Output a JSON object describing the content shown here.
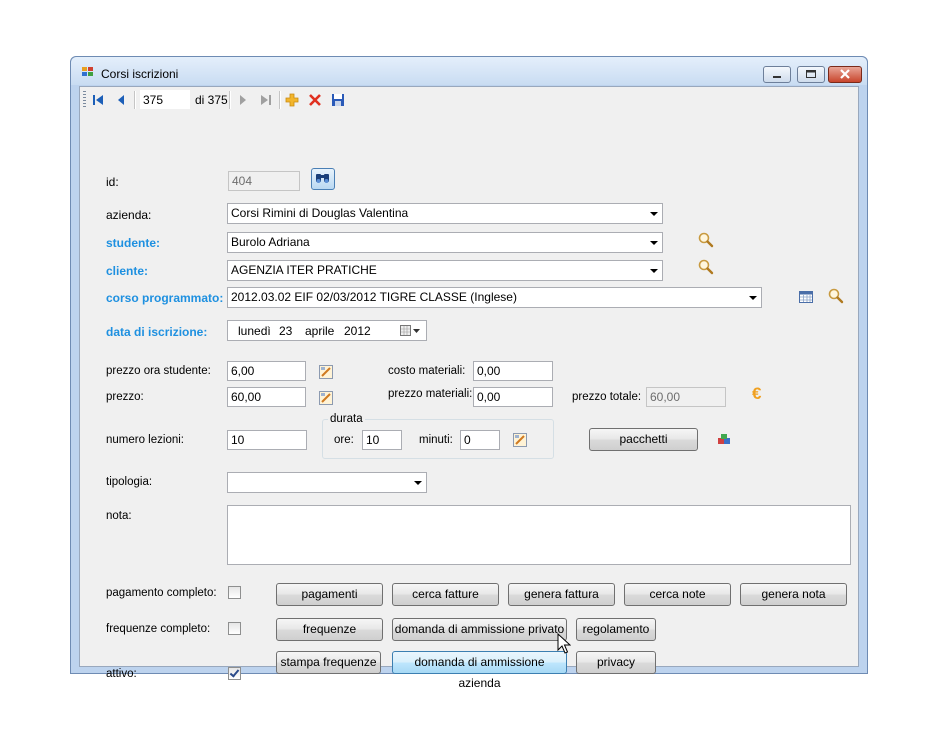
{
  "window": {
    "title": "Corsi iscrizioni"
  },
  "toolbar": {
    "position": "375",
    "count_label": "di 375"
  },
  "form": {
    "id_label": "id:",
    "id_value": "404",
    "azienda_label": "azienda:",
    "azienda_value": "Corsi Rimini di Douglas Valentina",
    "studente_label": "studente:",
    "studente_value": "Burolo Adriana",
    "cliente_label": "cliente:",
    "cliente_value": "AGENZIA ITER PRATICHE",
    "corso_label": "corso programmato:",
    "corso_value": "2012.03.02 EIF  02/03/2012 TIGRE CLASSE (Inglese)",
    "data_label": "data di iscrizione:",
    "date": {
      "weekday": "lunedì",
      "day": "23",
      "month": "aprile",
      "year": "2012"
    },
    "prezzo_ora_label": "prezzo ora studente:",
    "prezzo_ora_value": "6,00",
    "costo_materiali_label": "costo materiali:",
    "costo_materiali_value": "0,00",
    "prezzo_label": "prezzo:",
    "prezzo_value": "60,00",
    "prezzo_materiali_label": "prezzo materiali:",
    "prezzo_materiali_value": "0,00",
    "prezzo_totale_label": "prezzo totale:",
    "prezzo_totale_value": "60,00",
    "numero_lezioni_label": "numero lezioni:",
    "numero_lezioni_value": "10",
    "durata_label": "durata",
    "ore_label": "ore:",
    "ore_value": "10",
    "minuti_label": "minuti:",
    "minuti_value": "0",
    "tipologia_label": "tipologia:",
    "tipologia_value": "",
    "nota_label": "nota:",
    "nota_value": "",
    "pagamento_label": "pagamento completo:",
    "pagamento_checked": false,
    "frequenze_label": "frequenze completo:",
    "frequenze_checked": false,
    "attivo_label": "attivo:",
    "attivo_checked": true
  },
  "buttons": {
    "pacchetti": "pacchetti",
    "pagamenti": "pagamenti",
    "cerca_fatture": "cerca fatture",
    "genera_fattura": "genera fattura",
    "cerca_note": "cerca note",
    "genera_nota": "genera nota",
    "frequenze": "frequenze",
    "domanda_privato": "domanda di ammissione privato",
    "regolamento": "regolamento",
    "stampa_frequenze": "stampa frequenze",
    "domanda_azienda": "domanda di ammissione azienda",
    "privacy": "privacy"
  },
  "colors": {
    "accent_label": "#1e90e0",
    "window_frame": "#bdd3ee",
    "client_bg": "#f0f0f0"
  }
}
